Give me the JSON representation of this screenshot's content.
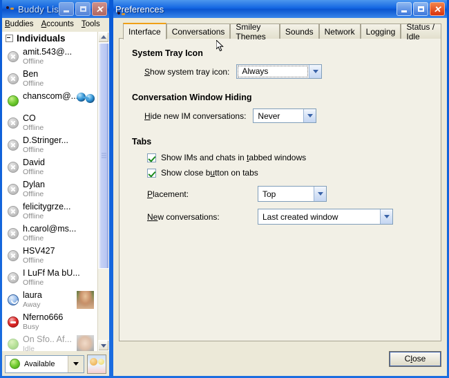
{
  "buddy_list": {
    "title": "Buddy List",
    "window_buttons": {
      "minimize": "_",
      "maximize": "□",
      "close": "X"
    },
    "menu": [
      {
        "label": "Buddies",
        "mnemonic": "B"
      },
      {
        "label": "Accounts",
        "mnemonic": "A"
      },
      {
        "label": "Tools",
        "mnemonic": "T"
      }
    ],
    "group": {
      "label": "Individuals",
      "expanded": true
    },
    "buddies": [
      {
        "name": "amit.543@...",
        "status": "Offline",
        "presence": "offline",
        "emblem": "none",
        "avatar": "none"
      },
      {
        "name": "Ben",
        "status": "Offline",
        "presence": "offline",
        "emblem": "none",
        "avatar": "none"
      },
      {
        "name": "chanscom@...",
        "status": "",
        "presence": "available",
        "emblem": "im-conversation",
        "avatar": "none"
      },
      {
        "name": "CO",
        "status": "Offline",
        "presence": "offline",
        "emblem": "none",
        "avatar": "none"
      },
      {
        "name": "D.Stringer...",
        "status": "Offline",
        "presence": "offline",
        "emblem": "none",
        "avatar": "none"
      },
      {
        "name": "David",
        "status": "Offline",
        "presence": "offline",
        "emblem": "none",
        "avatar": "none"
      },
      {
        "name": "Dylan",
        "status": "Offline",
        "presence": "offline",
        "emblem": "none",
        "avatar": "none"
      },
      {
        "name": "felicitygrze...",
        "status": "Offline",
        "presence": "offline",
        "emblem": "none",
        "avatar": "none"
      },
      {
        "name": "h.carol@ms...",
        "status": "Offline",
        "presence": "offline",
        "emblem": "none",
        "avatar": "none"
      },
      {
        "name": "HSV427",
        "status": "Offline",
        "presence": "offline",
        "emblem": "none",
        "avatar": "none"
      },
      {
        "name": "I LuFf Ma bU...",
        "status": "Offline",
        "presence": "offline",
        "emblem": "none",
        "avatar": "none"
      },
      {
        "name": "laura",
        "status": "Away",
        "presence": "away",
        "emblem": "none",
        "avatar": "photo-laura"
      },
      {
        "name": "Nferno666",
        "status": "Busy",
        "presence": "busy",
        "emblem": "none",
        "avatar": "none"
      },
      {
        "name": "On Sfo.. Af...",
        "status": "Idle",
        "presence": "idle",
        "emblem": "none",
        "avatar": "photo-baby"
      }
    ],
    "status_selector": {
      "value": "Available",
      "presence": "available"
    },
    "scrollbar": {
      "up_icon": "chevron-up-icon",
      "down_icon": "chevron-down-icon"
    }
  },
  "preferences": {
    "title": "Preferences",
    "window_buttons": {
      "minimize": "_",
      "maximize": "□",
      "close": "X"
    },
    "tabs": [
      {
        "label": "Interface",
        "active": true
      },
      {
        "label": "Conversations",
        "active": false
      },
      {
        "label": "Smiley Themes",
        "active": false
      },
      {
        "label": "Sounds",
        "active": false
      },
      {
        "label": "Network",
        "active": false
      },
      {
        "label": "Logging",
        "active": false
      },
      {
        "label": "Status / Idle",
        "active": false
      }
    ],
    "sections": {
      "system_tray": {
        "heading": "System Tray Icon",
        "show_tray_icon": {
          "label_pre": "S",
          "label_post": "how system tray icon:",
          "value": "Always"
        }
      },
      "conversation_hiding": {
        "heading": "Conversation Window Hiding",
        "hide_new_ims": {
          "label_pre": "H",
          "label_post": "ide new IM conversations:",
          "value": "Never"
        }
      },
      "tabs_section": {
        "heading": "Tabs",
        "checkbox_tabbed": {
          "pre": "Show IMs and chats in ",
          "mnemonic": "t",
          "post": "abbed windows",
          "checked": true
        },
        "checkbox_close_button": {
          "pre": "Show close b",
          "mnemonic": "u",
          "post": "tton on tabs",
          "checked": true
        },
        "placement": {
          "label_pre": "P",
          "label_post": "lacement:",
          "value": "Top"
        },
        "new_conversations": {
          "label_pre": "N",
          "label_mid": "e",
          "label_post": "w conversations:",
          "value": "Last created window"
        }
      }
    },
    "footer": {
      "close_pre": "C",
      "close_mnemonic": "l",
      "close_post": "ose"
    }
  },
  "colors": {
    "titlebar_active": "#0a55d0",
    "titlebar_inactive": "#1263de",
    "panel_bg": "#ece9d8",
    "tabpanel_bg": "#f2f0e6",
    "accent_tab": "#f0a015",
    "status_available": "#72cc31",
    "status_busy": "#df2b2b",
    "status_away": "#3e6fb5",
    "status_offline": "#c6c6c6"
  }
}
